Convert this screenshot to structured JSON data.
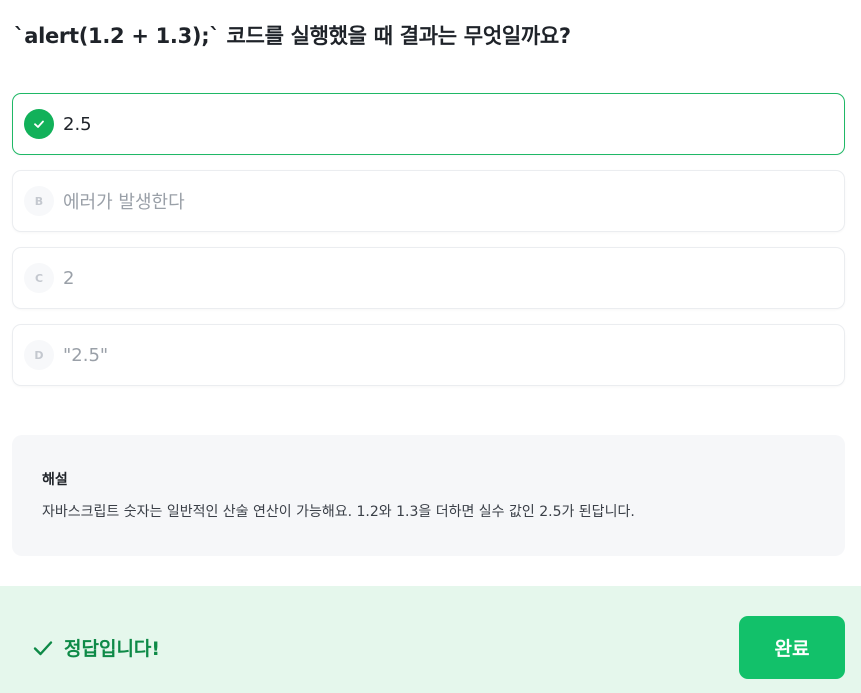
{
  "question": {
    "text": "`alert(1.2 + 1.3);` 코드를 실행했을 때 결과는 무엇일까요?"
  },
  "options": [
    {
      "letter": "",
      "label": "2.5",
      "state": "correct",
      "icon": "check-icon"
    },
    {
      "letter": "B",
      "label": "에러가 발생한다",
      "state": "disabled"
    },
    {
      "letter": "C",
      "label": "2",
      "state": "disabled"
    },
    {
      "letter": "D",
      "label": "\"2.5\"",
      "state": "disabled"
    }
  ],
  "explanation": {
    "title": "해설",
    "body": "자바스크립트 숫자는 일반적인 산술 연산이 가능해요. 1.2와 1.3을 더하면 실수 값인 2.5가 된답니다."
  },
  "footer": {
    "result_text": "정답입니다!",
    "result_icon": "check-icon",
    "finish_label": "완료"
  },
  "colors": {
    "accent": "#12c16a",
    "correct_border": "#1fb866",
    "footer_bg": "#e5f7ec",
    "result_text": "#0e8a47"
  }
}
